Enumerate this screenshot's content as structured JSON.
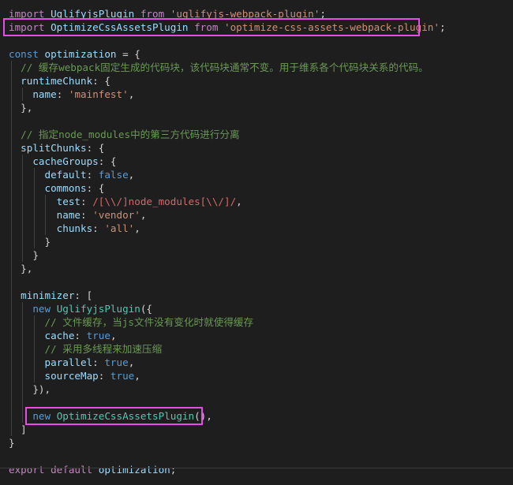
{
  "editor": {
    "language": "javascript",
    "theme": "dark",
    "highlight_color": "#e64ce6",
    "lines": [
      [
        {
          "t": "import",
          "c": "ctrl"
        },
        {
          "t": " "
        },
        {
          "t": "UglifyjsPlugin",
          "c": "var"
        },
        {
          "t": " "
        },
        {
          "t": "from",
          "c": "ctrl"
        },
        {
          "t": " "
        },
        {
          "t": "'uglifyjs-webpack-plugin'",
          "c": "str"
        },
        {
          "t": ";"
        }
      ],
      [
        {
          "t": "import",
          "c": "ctrl"
        },
        {
          "t": " "
        },
        {
          "t": "OptimizeCssAssetsPlugin",
          "c": "var"
        },
        {
          "t": " "
        },
        {
          "t": "from",
          "c": "ctrl"
        },
        {
          "t": " "
        },
        {
          "t": "'optimize-css-assets-webpack-plugin'",
          "c": "str"
        },
        {
          "t": ";"
        }
      ],
      [],
      [
        {
          "t": "const",
          "c": "kw"
        },
        {
          "t": " "
        },
        {
          "t": "optimization",
          "c": "var"
        },
        {
          "t": " = {"
        }
      ],
      [
        {
          "t": "  "
        },
        {
          "t": "// 缓存webpack固定生成的代码块，该代码块通常不变。用于维系各个代码块关系的代码。",
          "c": "cm"
        }
      ],
      [
        {
          "t": "  "
        },
        {
          "t": "runtimeChunk",
          "c": "prop"
        },
        {
          "t": ": {"
        }
      ],
      [
        {
          "t": "    "
        },
        {
          "t": "name",
          "c": "prop"
        },
        {
          "t": ": "
        },
        {
          "t": "'mainfest'",
          "c": "str"
        },
        {
          "t": ","
        }
      ],
      [
        {
          "t": "  },"
        }
      ],
      [],
      [
        {
          "t": "  "
        },
        {
          "t": "// 指定node_modules中的第三方代码进行分离",
          "c": "cm"
        }
      ],
      [
        {
          "t": "  "
        },
        {
          "t": "splitChunks",
          "c": "prop"
        },
        {
          "t": ": {"
        }
      ],
      [
        {
          "t": "    "
        },
        {
          "t": "cacheGroups",
          "c": "prop"
        },
        {
          "t": ": {"
        }
      ],
      [
        {
          "t": "      "
        },
        {
          "t": "default",
          "c": "prop"
        },
        {
          "t": ": "
        },
        {
          "t": "false",
          "c": "bool"
        },
        {
          "t": ","
        }
      ],
      [
        {
          "t": "      "
        },
        {
          "t": "commons",
          "c": "prop"
        },
        {
          "t": ": {"
        }
      ],
      [
        {
          "t": "        "
        },
        {
          "t": "test",
          "c": "prop"
        },
        {
          "t": ": "
        },
        {
          "t": "/[\\\\/]node_modules[\\\\/]/",
          "c": "re"
        },
        {
          "t": ","
        }
      ],
      [
        {
          "t": "        "
        },
        {
          "t": "name",
          "c": "prop"
        },
        {
          "t": ": "
        },
        {
          "t": "'vendor'",
          "c": "str"
        },
        {
          "t": ","
        }
      ],
      [
        {
          "t": "        "
        },
        {
          "t": "chunks",
          "c": "prop"
        },
        {
          "t": ": "
        },
        {
          "t": "'all'",
          "c": "str"
        },
        {
          "t": ","
        }
      ],
      [
        {
          "t": "      }"
        }
      ],
      [
        {
          "t": "    }"
        }
      ],
      [
        {
          "t": "  },"
        }
      ],
      [],
      [
        {
          "t": "  "
        },
        {
          "t": "minimizer",
          "c": "prop"
        },
        {
          "t": ": ["
        }
      ],
      [
        {
          "t": "    "
        },
        {
          "t": "new",
          "c": "kw"
        },
        {
          "t": " "
        },
        {
          "t": "UglifyjsPlugin",
          "c": "cls"
        },
        {
          "t": "({"
        }
      ],
      [
        {
          "t": "      "
        },
        {
          "t": "// 文件缓存，当js文件没有变化时就使得缓存",
          "c": "cm"
        }
      ],
      [
        {
          "t": "      "
        },
        {
          "t": "cache",
          "c": "prop"
        },
        {
          "t": ": "
        },
        {
          "t": "true",
          "c": "bool"
        },
        {
          "t": ","
        }
      ],
      [
        {
          "t": "      "
        },
        {
          "t": "// 采用多线程来加速压缩",
          "c": "cm"
        }
      ],
      [
        {
          "t": "      "
        },
        {
          "t": "parallel",
          "c": "prop"
        },
        {
          "t": ": "
        },
        {
          "t": "true",
          "c": "bool"
        },
        {
          "t": ","
        }
      ],
      [
        {
          "t": "      "
        },
        {
          "t": "sourceMap",
          "c": "prop"
        },
        {
          "t": ": "
        },
        {
          "t": "true",
          "c": "bool"
        },
        {
          "t": ","
        }
      ],
      [
        {
          "t": "    }),"
        }
      ],
      [],
      [
        {
          "t": "    "
        },
        {
          "t": "new",
          "c": "kw"
        },
        {
          "t": " "
        },
        {
          "t": "OptimizeCssAssetsPlugin",
          "c": "cls"
        },
        {
          "t": "(),"
        }
      ],
      [
        {
          "t": "  ]"
        }
      ],
      [
        {
          "t": "}"
        }
      ],
      [],
      [
        {
          "t": "export",
          "c": "ctrl"
        },
        {
          "t": " "
        },
        {
          "t": "default",
          "c": "ctrl"
        },
        {
          "t": " "
        },
        {
          "t": "optimization",
          "c": "var"
        },
        {
          "t": ";"
        }
      ]
    ],
    "highlighted_lines": [
      {
        "name": "highlight-import-optimize-css",
        "line": 1
      },
      {
        "name": "highlight-new-optimize-css",
        "line": 30
      }
    ]
  }
}
